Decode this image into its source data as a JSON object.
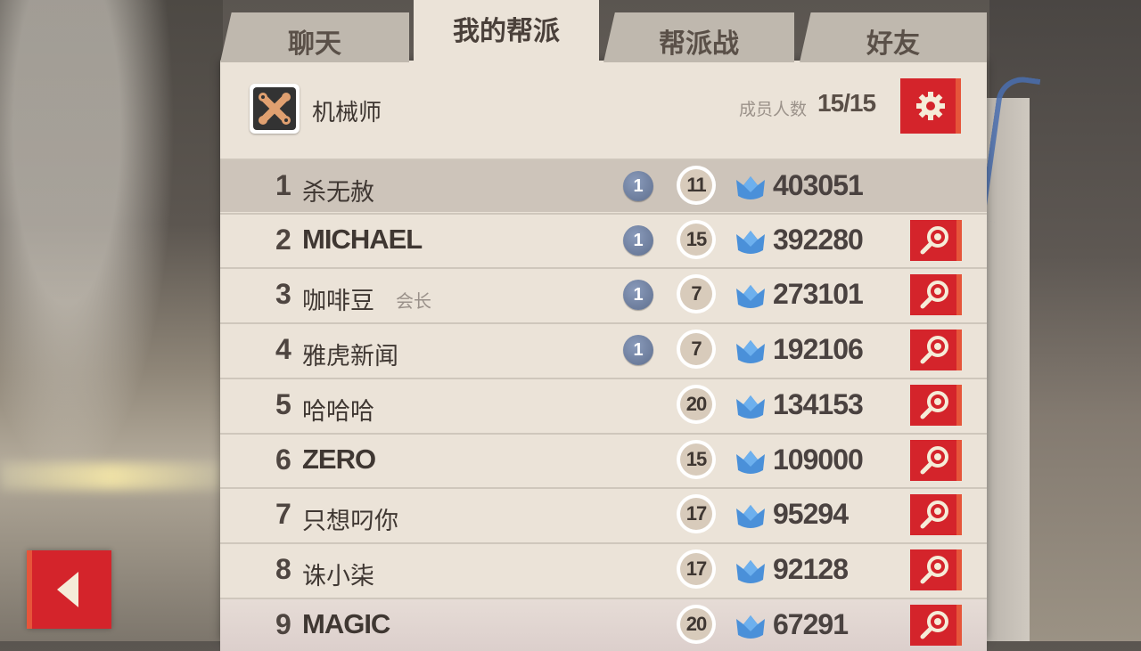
{
  "tabs": [
    {
      "label": "聊天"
    },
    {
      "label": "我的帮派"
    },
    {
      "label": "帮派战"
    },
    {
      "label": "好友"
    }
  ],
  "guild": {
    "name": "机械师",
    "member_label": "成员人数",
    "member_count": "15/15"
  },
  "members": [
    {
      "rank": "1",
      "name": "杀无赦",
      "role": "",
      "badge": "1",
      "level": "11",
      "score": "403051"
    },
    {
      "rank": "2",
      "name": "MICHAEL",
      "role": "",
      "badge": "1",
      "level": "15",
      "score": "392280"
    },
    {
      "rank": "3",
      "name": "咖啡豆",
      "role": "会长",
      "badge": "1",
      "level": "7",
      "score": "273101"
    },
    {
      "rank": "4",
      "name": "雅虎新闻",
      "role": "",
      "badge": "1",
      "level": "7",
      "score": "192106"
    },
    {
      "rank": "5",
      "name": "哈哈哈",
      "role": "",
      "badge": "",
      "level": "20",
      "score": "134153"
    },
    {
      "rank": "6",
      "name": "ZERO",
      "role": "",
      "badge": "",
      "level": "15",
      "score": "109000"
    },
    {
      "rank": "7",
      "name": "只想叼你",
      "role": "",
      "badge": "",
      "level": "17",
      "score": "95294"
    },
    {
      "rank": "8",
      "name": "诛小柒",
      "role": "",
      "badge": "",
      "level": "17",
      "score": "92128"
    },
    {
      "rank": "9",
      "name": "MAGIC",
      "role": "",
      "badge": "",
      "level": "20",
      "score": "67291"
    }
  ],
  "colors": {
    "accent_red": "#d4242b",
    "crown_blue": "#4a90d9",
    "panel": "#ebe3d8"
  },
  "icons": {
    "settings": "gear-icon",
    "inspect": "magnifier-icon",
    "back": "back-arrow-icon",
    "score": "crown-icon",
    "guild": "wrench-emblem-icon"
  }
}
